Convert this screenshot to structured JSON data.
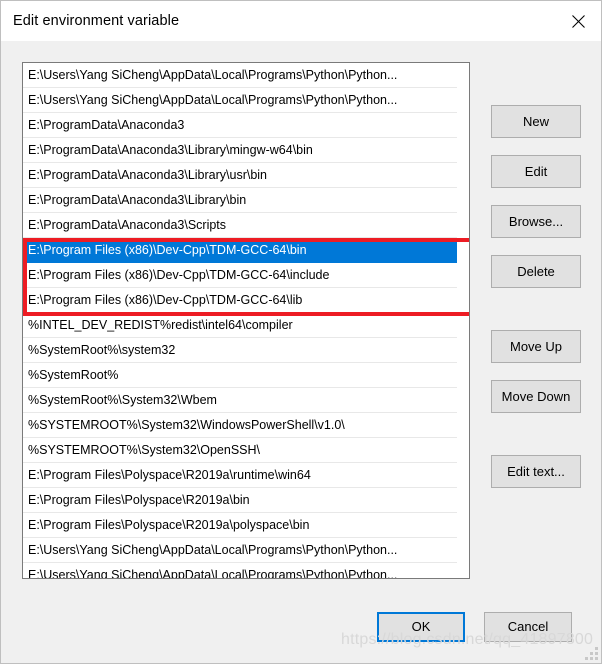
{
  "window": {
    "title": "Edit environment variable",
    "close_icon": "close-icon"
  },
  "list": {
    "items": [
      {
        "text": "E:\\Users\\Yang SiCheng\\AppData\\Local\\Programs\\Python\\Python...",
        "selected": false
      },
      {
        "text": "E:\\Users\\Yang SiCheng\\AppData\\Local\\Programs\\Python\\Python...",
        "selected": false
      },
      {
        "text": "E:\\ProgramData\\Anaconda3",
        "selected": false
      },
      {
        "text": "E:\\ProgramData\\Anaconda3\\Library\\mingw-w64\\bin",
        "selected": false
      },
      {
        "text": "E:\\ProgramData\\Anaconda3\\Library\\usr\\bin",
        "selected": false
      },
      {
        "text": "E:\\ProgramData\\Anaconda3\\Library\\bin",
        "selected": false
      },
      {
        "text": "E:\\ProgramData\\Anaconda3\\Scripts",
        "selected": false
      },
      {
        "text": "E:\\Program Files (x86)\\Dev-Cpp\\TDM-GCC-64\\bin",
        "selected": true
      },
      {
        "text": "E:\\Program Files (x86)\\Dev-Cpp\\TDM-GCC-64\\include",
        "selected": false
      },
      {
        "text": "E:\\Program Files (x86)\\Dev-Cpp\\TDM-GCC-64\\lib",
        "selected": false
      },
      {
        "text": "%INTEL_DEV_REDIST%redist\\intel64\\compiler",
        "selected": false
      },
      {
        "text": "%SystemRoot%\\system32",
        "selected": false
      },
      {
        "text": "%SystemRoot%",
        "selected": false
      },
      {
        "text": "%SystemRoot%\\System32\\Wbem",
        "selected": false
      },
      {
        "text": "%SYSTEMROOT%\\System32\\WindowsPowerShell\\v1.0\\",
        "selected": false
      },
      {
        "text": "%SYSTEMROOT%\\System32\\OpenSSH\\",
        "selected": false
      },
      {
        "text": "E:\\Program Files\\Polyspace\\R2019a\\runtime\\win64",
        "selected": false
      },
      {
        "text": "E:\\Program Files\\Polyspace\\R2019a\\bin",
        "selected": false
      },
      {
        "text": "E:\\Program Files\\Polyspace\\R2019a\\polyspace\\bin",
        "selected": false
      },
      {
        "text": "E:\\Users\\Yang SiCheng\\AppData\\Local\\Programs\\Python\\Python...",
        "selected": false
      },
      {
        "text": "E:\\Users\\Yang SiCheng\\AppData\\Local\\Programs\\Python\\Python...",
        "selected": false
      },
      {
        "text": "",
        "selected": false
      }
    ],
    "selection_color": "#0078d7",
    "annotation_color": "#ed1c24"
  },
  "side_buttons": {
    "new": "New",
    "edit": "Edit",
    "browse": "Browse...",
    "delete": "Delete",
    "move_up": "Move Up",
    "move_down": "Move Down",
    "edit_text": "Edit text..."
  },
  "footer": {
    "ok": "OK",
    "cancel": "Cancel",
    "focus_color": "#0078d7"
  },
  "watermark": {
    "text": "https://blog.csdn.net/qq_41897800"
  }
}
